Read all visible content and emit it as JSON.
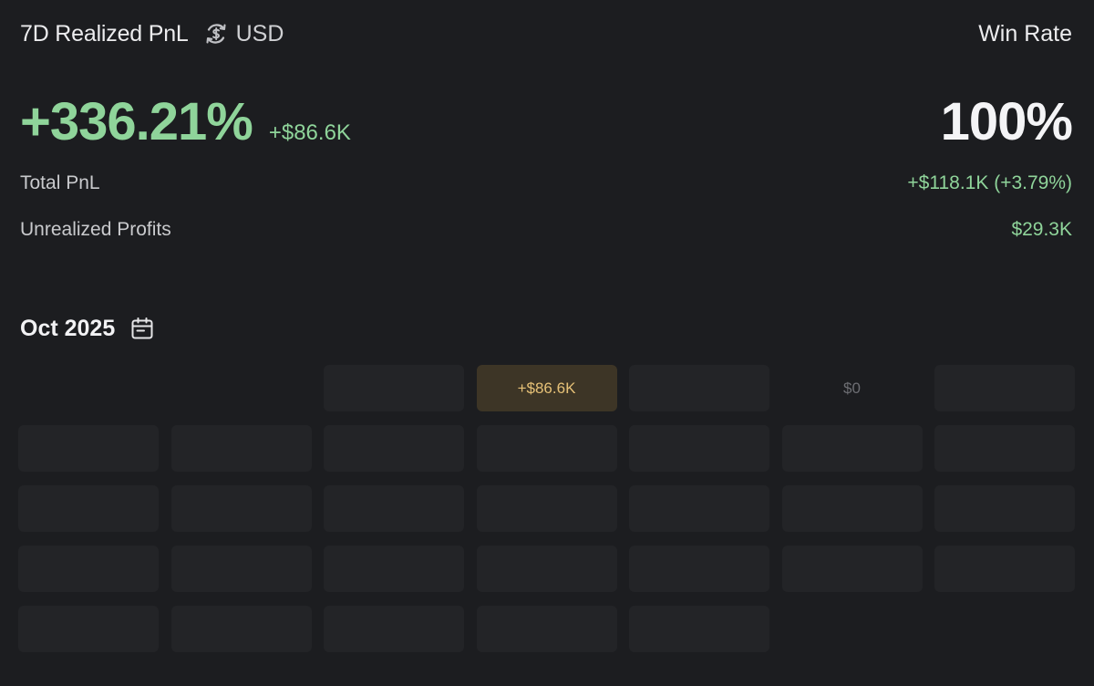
{
  "header": {
    "title": "7D Realized PnL",
    "currency_icon": "dollar-cycle-icon",
    "currency": "USD",
    "win_rate_label": "Win Rate"
  },
  "summary": {
    "realized_pct": "+336.21%",
    "realized_usd": "+$86.6K",
    "win_rate": "100%"
  },
  "stats": {
    "total_pnl_label": "Total PnL",
    "total_pnl_value": "+$118.1K (+3.79%)",
    "unrealized_label": "Unrealized Profits",
    "unrealized_value": "$29.3K"
  },
  "calendar": {
    "month": "Oct 2025",
    "icon": "calendar-icon",
    "accent_positive": "#e6c177",
    "weeks": [
      [
        {
          "type": "empty",
          "label": ""
        },
        {
          "type": "empty",
          "label": ""
        },
        {
          "type": "day",
          "label": ""
        },
        {
          "type": "positive",
          "label": "+$86.6K"
        },
        {
          "type": "day",
          "label": ""
        },
        {
          "type": "zero",
          "label": "$0"
        },
        {
          "type": "day",
          "label": ""
        }
      ],
      [
        {
          "type": "day",
          "label": ""
        },
        {
          "type": "day",
          "label": ""
        },
        {
          "type": "day",
          "label": ""
        },
        {
          "type": "day",
          "label": ""
        },
        {
          "type": "day",
          "label": ""
        },
        {
          "type": "day",
          "label": ""
        },
        {
          "type": "day",
          "label": ""
        }
      ],
      [
        {
          "type": "day",
          "label": ""
        },
        {
          "type": "day",
          "label": ""
        },
        {
          "type": "day",
          "label": ""
        },
        {
          "type": "day",
          "label": ""
        },
        {
          "type": "day",
          "label": ""
        },
        {
          "type": "day",
          "label": ""
        },
        {
          "type": "day",
          "label": ""
        }
      ],
      [
        {
          "type": "day",
          "label": ""
        },
        {
          "type": "day",
          "label": ""
        },
        {
          "type": "day",
          "label": ""
        },
        {
          "type": "day",
          "label": ""
        },
        {
          "type": "day",
          "label": ""
        },
        {
          "type": "day",
          "label": ""
        },
        {
          "type": "day",
          "label": ""
        }
      ],
      [
        {
          "type": "day",
          "label": ""
        },
        {
          "type": "day",
          "label": ""
        },
        {
          "type": "day",
          "label": ""
        },
        {
          "type": "day",
          "label": ""
        },
        {
          "type": "day",
          "label": ""
        }
      ]
    ]
  }
}
